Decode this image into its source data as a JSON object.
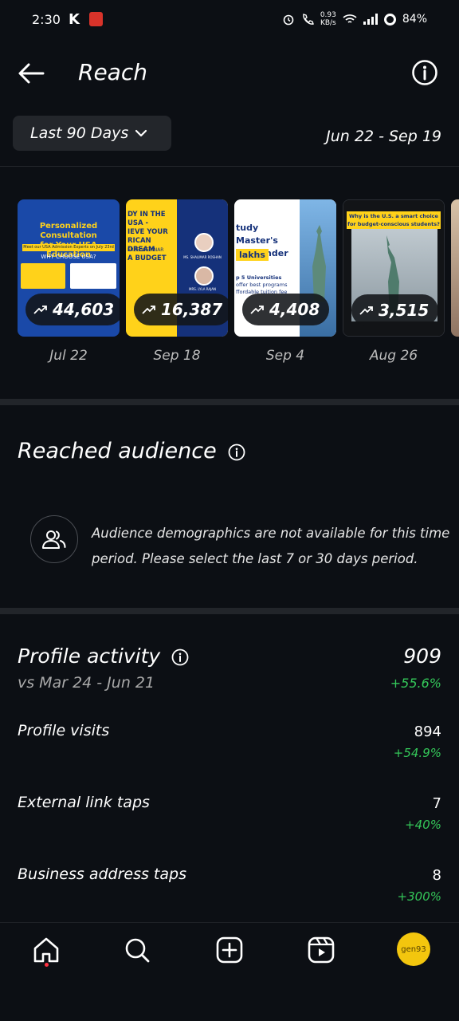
{
  "status_bar": {
    "time": "2:30",
    "app_letter": "K",
    "speed_top": "0.93",
    "speed_unit": "KB/s",
    "battery": "84%"
  },
  "header": {
    "title": "Reach"
  },
  "filter": {
    "range_label": "Last 90 Days",
    "date_range": "Jun 22 - Sep 19"
  },
  "posts": [
    {
      "reach": "44,603",
      "date": "Jul 22",
      "thumb_text": [
        "Personalized Consultation",
        "for Your USA Education",
        "Meet our USA Admission Experts on July 23rd",
        "WHY CHOOSE USA?"
      ]
    },
    {
      "reach": "16,387",
      "date": "Sep 18",
      "thumb_text": [
        "DY IN THE USA -",
        "IEVE YOUR",
        "RICAN DREAM",
        "A BUDGET",
        "FREE WEBINAR",
        "MS. SHALIMAR ROSHAN",
        "MRS. LYLA RAJAN"
      ]
    },
    {
      "reach": "4,408",
      "date": "Sep 4",
      "thumb_text": [
        "tudy Master's",
        "USA under",
        "lakhs",
        "p 5 Universities",
        "offer best programs",
        "ffordable tuition fee"
      ]
    },
    {
      "reach": "3,515",
      "date": "Aug 26",
      "thumb_text": [
        "Why is the U.S. a smart choice",
        "for budget-conscious students?"
      ]
    }
  ],
  "reached_audience": {
    "title": "Reached audience",
    "note_line1": "Audience demographics are not available for this time",
    "note_line2": "period. Please select the last 7 or 30 days period."
  },
  "profile_activity": {
    "title": "Profile activity",
    "total": "909",
    "compare": "vs Mar 24 - Jun 21",
    "total_change": "+55.6%",
    "metrics": [
      {
        "label": "Profile visits",
        "value": "894",
        "change": "+54.9%"
      },
      {
        "label": "External link taps",
        "value": "7",
        "change": "+40%"
      },
      {
        "label": "Business address taps",
        "value": "8",
        "change": "+300%"
      }
    ]
  },
  "nav": {
    "avatar_text": "gen93"
  },
  "colors": {
    "background": "#0c0f14",
    "positive": "#34c759",
    "chip": "#23262b",
    "avatar": "#f3c60e"
  }
}
